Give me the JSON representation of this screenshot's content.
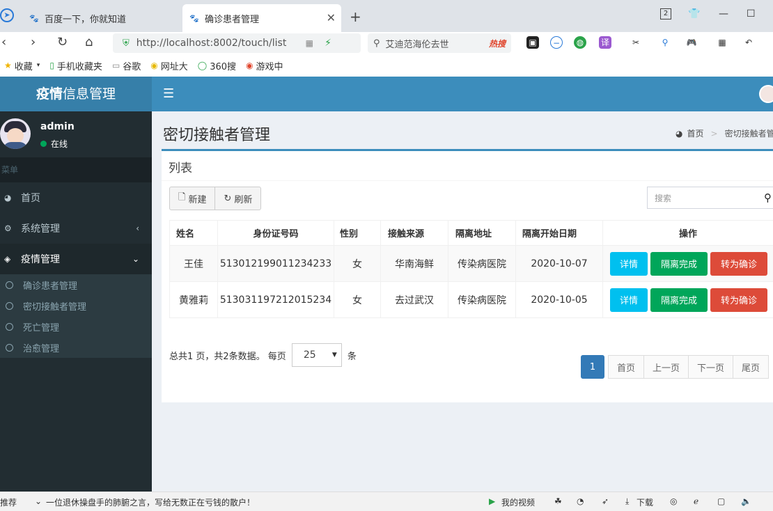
{
  "browser": {
    "tabs": [
      {
        "label": "百度一下，你就知道"
      },
      {
        "label": "确诊患者管理"
      }
    ],
    "url": "http://localhost:8002/touch/list",
    "search_text": "艾迪范海伦去世",
    "hot_label": "热搜",
    "page_index_badge": "2",
    "bookmarks": [
      {
        "label": "收藏"
      },
      {
        "label": "手机收藏夹"
      },
      {
        "label": "谷歌"
      },
      {
        "label": "网址大"
      },
      {
        "label": "360搜"
      },
      {
        "label": "游戏中"
      }
    ],
    "status_bar": {
      "left_text": "推荐",
      "news": "一位退休操盘手的肺腑之言，写给无数正在亏钱的散户！",
      "my_video": "我的视频",
      "download": "下载"
    }
  },
  "app": {
    "logo_bold": "疫情",
    "logo_rest": "信息管理",
    "user": {
      "name": "admin",
      "status": "在线"
    },
    "menu_header": "菜单",
    "menu": [
      {
        "label": "首页",
        "icon": "dashboard-icon"
      },
      {
        "label": "系统管理",
        "icon": "cogs-icon"
      },
      {
        "label": "疫情管理",
        "icon": "cube-icon"
      }
    ],
    "submenu": [
      {
        "label": "确诊患者管理"
      },
      {
        "label": "密切接触者管理"
      },
      {
        "label": "死亡管理"
      },
      {
        "label": "治愈管理"
      }
    ],
    "page_title": "密切接触者管理",
    "breadcrumb": {
      "home": "首页",
      "current": "密切接触者管"
    },
    "box_title": "列表",
    "toolbar": {
      "new_label": "新建",
      "refresh_label": "刷新"
    },
    "search_placeholder": "搜索",
    "table": {
      "headers": [
        "姓名",
        "身份证号码",
        "性别",
        "接触来源",
        "隔离地址",
        "隔离开始日期",
        "操作"
      ],
      "rows": [
        {
          "name": "王佳",
          "id": "513012199011234233",
          "sex": "女",
          "source": "华南海鲜",
          "address": "传染病医院",
          "date": "2020-10-07"
        },
        {
          "name": "黄雅莉",
          "id": "513031197212015234",
          "sex": "女",
          "source": "去过武汉",
          "address": "传染病医院",
          "date": "2020-10-05"
        }
      ],
      "actions": {
        "detail": "详情",
        "done": "隔离完成",
        "confirm": "转为确诊"
      }
    },
    "pager": {
      "summary": "总共1 页，共2条数据。 每页",
      "page_size": "25",
      "unit": "条",
      "current": "1",
      "first": "首页",
      "prev": "上一页",
      "next": "下一页",
      "last": "尾页"
    }
  },
  "colors": {
    "header_blue": "#3c8dbc",
    "logo_blue": "#367fa9",
    "sidebar": "#222d32",
    "info": "#00c0ef",
    "success": "#00a65a",
    "danger": "#dd4b39",
    "page_active": "#337ab7"
  }
}
